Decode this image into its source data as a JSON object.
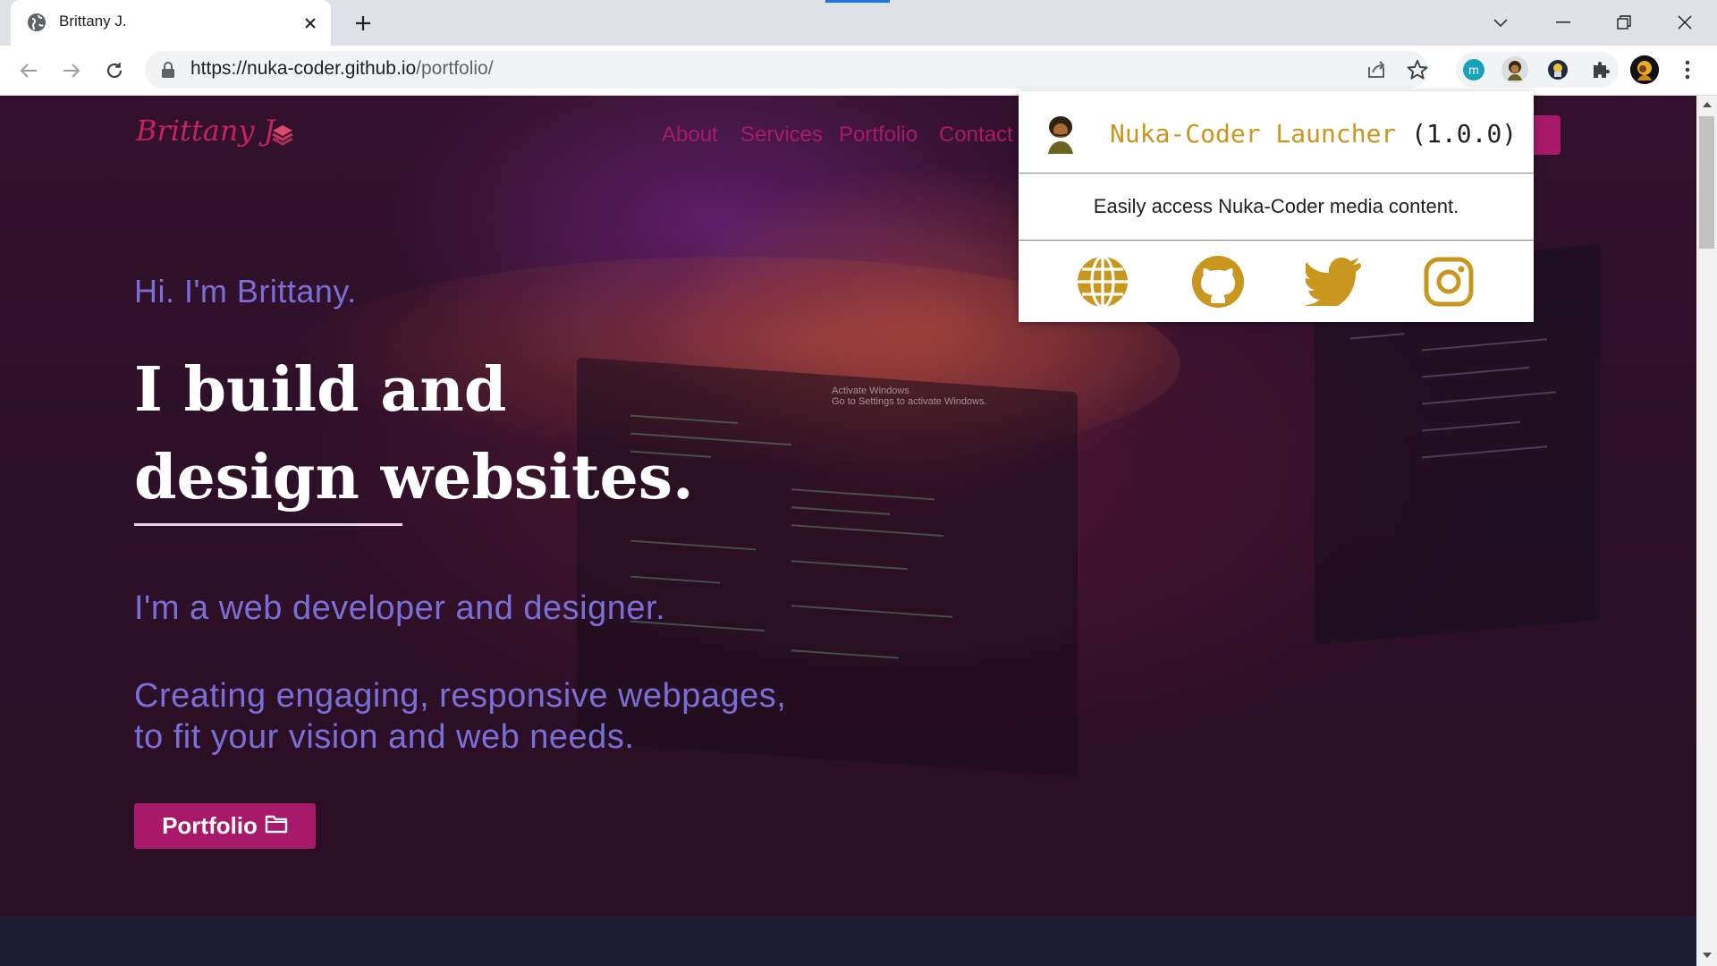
{
  "browser": {
    "tab": {
      "title": "Brittany J.",
      "favicon": "globe-icon"
    },
    "url": {
      "host": "https://nuka-coder.github.io",
      "path": "/portfolio/"
    }
  },
  "site": {
    "logo": "Brittany J.",
    "nav": [
      "About",
      "Services",
      "Portfolio",
      "Contact"
    ],
    "hero": {
      "greeting": "Hi. I'm Brittany.",
      "headline_line1": "I build and",
      "headline_line2": "design websites.",
      "tagline": "I'm a web developer and designer.",
      "subtext_line1": "Creating engaging, responsive webpages,",
      "subtext_line2": "to fit your vision and web needs.",
      "button_label": "Portfolio",
      "button_icon": "folder-icon"
    },
    "watermark_line1": "Activate Windows",
    "watermark_line2": "Go to Settings to activate Windows."
  },
  "extension_popup": {
    "title": "Nuka-Coder Launcher",
    "version": "(1.0.0)",
    "description": "Easily access Nuka-Coder media content.",
    "links": [
      "globe-icon",
      "github-icon",
      "twitter-icon",
      "instagram-icon"
    ]
  },
  "colors": {
    "accent_pink": "#a8196a",
    "popup_gold": "#c9961e",
    "hero_text_purple": "#7a6fd6",
    "chrome_blue": "#1a73e8"
  }
}
